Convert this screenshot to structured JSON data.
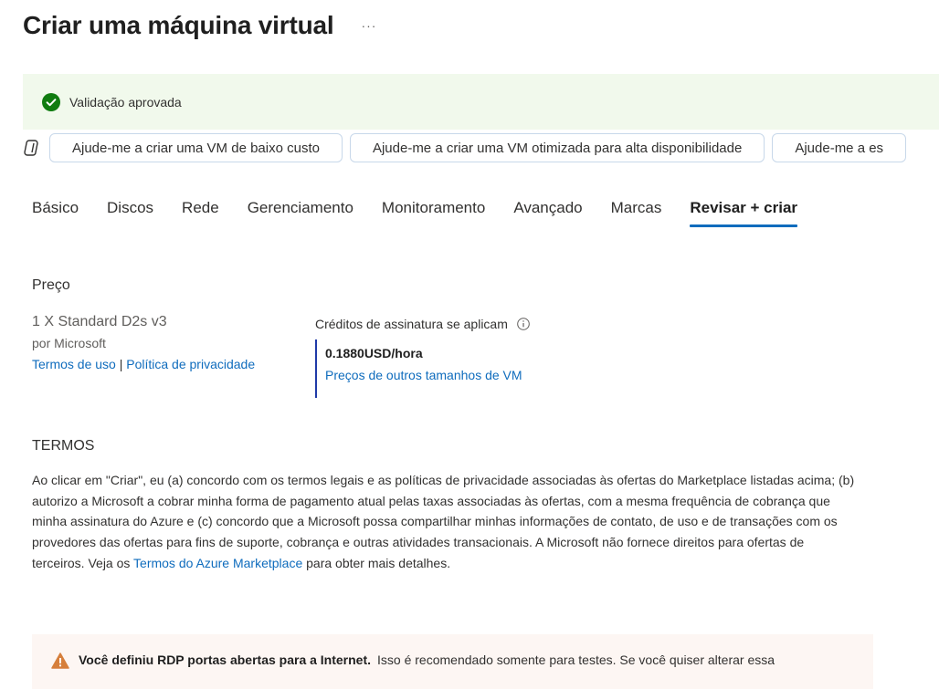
{
  "header": {
    "title": "Criar uma máquina virtual",
    "more_label": "···"
  },
  "validation": {
    "icon": "check-circle-icon",
    "text": "Validação aprovada",
    "color": "#107c10"
  },
  "copilot": {
    "icon": "copilot-icon",
    "suggestions": [
      "Ajude-me a criar uma VM de baixo custo",
      "Ajude-me a criar uma VM otimizada para alta disponibilidade",
      "Ajude-me a es"
    ]
  },
  "tabs": [
    {
      "label": "Básico",
      "active": false
    },
    {
      "label": "Discos",
      "active": false
    },
    {
      "label": "Rede",
      "active": false
    },
    {
      "label": "Gerenciamento",
      "active": false
    },
    {
      "label": "Monitoramento",
      "active": false
    },
    {
      "label": "Avançado",
      "active": false
    },
    {
      "label": "Marcas",
      "active": false
    },
    {
      "label": "Revisar + criar",
      "active": true
    }
  ],
  "price": {
    "section_title": "Preço",
    "product_name": "1 X Standard D2s v3",
    "publisher": "por Microsoft",
    "terms_link": "Termos de uso",
    "separator": "|",
    "privacy_link": "Política de privacidade",
    "credits_label": "Créditos de assinatura se aplicam",
    "info_icon": "info-icon",
    "hourly_price": "0.1880USD/hora",
    "other_sizes_link": "Preços de outros tamanhos de VM"
  },
  "terms": {
    "section_title": "TERMOS",
    "body_before_link": "Ao clicar em \"Criar\", eu (a) concordo com os termos legais e as políticas de privacidade associadas às ofertas do Marketplace listadas acima; (b) autorizo a Microsoft a cobrar minha forma de pagamento atual pelas taxas associadas às ofertas, com a mesma frequência de cobrança que minha assinatura do Azure e (c) concordo que a Microsoft possa compartilhar minhas informações de contato, de uso e de transações com os provedores das ofertas para fins de suporte, cobrança e outras atividades transacionais. A Microsoft não fornece direitos para ofertas de terceiros. Veja os ",
    "marketplace_link": "Termos do Azure Marketplace",
    "body_after_link": " para obter mais detalhes."
  },
  "warning": {
    "icon": "warning-icon",
    "bold_text": "Você definiu RDP portas abertas para a Internet.",
    "text": "Isso é recomendado somente para testes.  Se você quiser alterar essa",
    "color": "#d67f3c"
  },
  "colors": {
    "accent": "#0f6cbd",
    "success_bg": "#f1f9ec",
    "warning_bg": "#fdf6f3"
  }
}
